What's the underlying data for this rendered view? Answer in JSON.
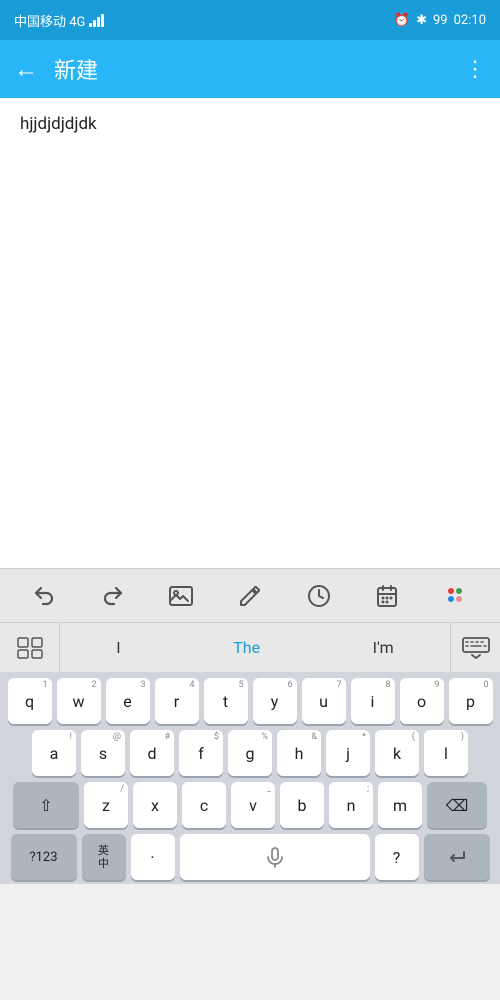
{
  "statusBar": {
    "carrier": "中国移动 4G",
    "time": "02:10",
    "battery": "99",
    "alarmIcon": "⏰",
    "bluetoothIcon": "⚡",
    "batteryLabel": "99"
  },
  "appBar": {
    "title": "新建",
    "backLabel": "←",
    "menuLabel": "⋮"
  },
  "editor": {
    "content": "hjjdjdjdjdk"
  },
  "suggestions": {
    "menuIcon": "⊞",
    "items": [
      "I",
      "The",
      "I'm"
    ],
    "hideIcon": "⌨"
  },
  "toolbar": {
    "undo": "↩",
    "redo": "↪",
    "image": "🖼",
    "edit": "✏",
    "clock": "🕐",
    "calendar": "📅",
    "magic": "✨"
  },
  "keyboard": {
    "row1": [
      {
        "label": "q",
        "number": "1"
      },
      {
        "label": "w",
        "number": "2"
      },
      {
        "label": "e",
        "number": "3"
      },
      {
        "label": "r",
        "number": "4"
      },
      {
        "label": "t",
        "number": "5"
      },
      {
        "label": "y",
        "number": "6"
      },
      {
        "label": "u",
        "number": "7"
      },
      {
        "label": "i",
        "number": "8"
      },
      {
        "label": "o",
        "number": "9"
      },
      {
        "label": "p",
        "number": "0"
      }
    ],
    "row2": [
      {
        "label": "a",
        "number": "!"
      },
      {
        "label": "s",
        "number": "@"
      },
      {
        "label": "d",
        "number": "#"
      },
      {
        "label": "f",
        "number": "$"
      },
      {
        "label": "g",
        "number": "%"
      },
      {
        "label": "h",
        "number": "&"
      },
      {
        "label": "j",
        "number": "*"
      },
      {
        "label": "k",
        "number": "("
      },
      {
        "label": "l",
        "number": ")"
      }
    ],
    "row3": [
      {
        "label": "⇧",
        "type": "dark",
        "wide": true
      },
      {
        "label": "z",
        "number": "/"
      },
      {
        "label": "x",
        "number": ""
      },
      {
        "label": "c",
        "number": ""
      },
      {
        "label": "v",
        "number": "_"
      },
      {
        "label": "b",
        "number": ""
      },
      {
        "label": "n",
        "number": ";"
      },
      {
        "label": "m",
        "number": ""
      },
      {
        "label": "⌫",
        "type": "dark",
        "wide": true
      }
    ],
    "row4": [
      {
        "label": "?123",
        "type": "dark",
        "wide": true
      },
      {
        "label": "英\n中",
        "type": "dark"
      },
      {
        "label": "·",
        "normal": true
      },
      {
        "label": "🎤",
        "space": true
      },
      {
        "label": "?",
        "normal": true
      },
      {
        "label": "↵",
        "type": "dark",
        "wide": true
      }
    ]
  }
}
